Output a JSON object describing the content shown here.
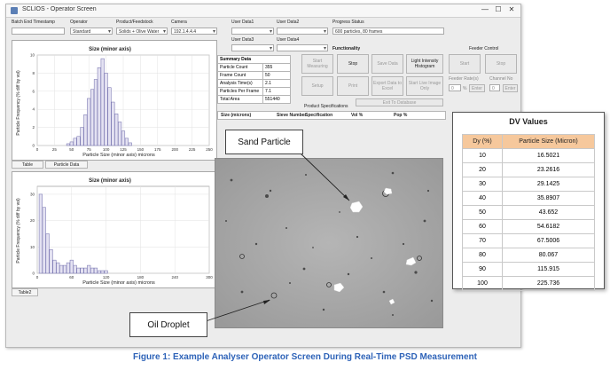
{
  "window": {
    "title": "SCLIOS - Operator Screen",
    "controls": [
      "—",
      "☐",
      "✕"
    ]
  },
  "header": {
    "labels": [
      "Batch End Timestamp",
      "Operator",
      "Product/Feedstock",
      "Camera",
      "User Data1",
      "User Data2",
      "Progress Status"
    ],
    "operator_value": "Standard",
    "product_value": "Solids + Olive Water",
    "camera_value": "192.1.4.4.4",
    "progress_value": "600 particles, 80 frames",
    "user_data3_label": "User Data3",
    "user_data4_label": "User Data4"
  },
  "chart1": {
    "title": "Size (minor axis)",
    "ylabel": "Particle Frequency (% diff by vol)",
    "xlabel": "Particle Size (minor axis) microns",
    "xticks": [
      "0",
      "25",
      "50",
      "75",
      "100",
      "125",
      "150",
      "175",
      "200",
      "225",
      "250"
    ],
    "yticks": [
      "0",
      "2",
      "4",
      "6",
      "8",
      "10"
    ]
  },
  "chart2": {
    "title": "Size (minor axis)",
    "ylabel": "Particle Frequency (% diff by vol)",
    "xlabel": "Particle Size (minor axis) microns",
    "xticks": [
      "0",
      "60",
      "120",
      "180",
      "240",
      "300"
    ],
    "yticks": [
      "0",
      "10",
      "20",
      "30"
    ]
  },
  "tabs": {
    "table": "Table",
    "particle_data": "Particle Data",
    "table2": "Table2"
  },
  "summary": {
    "header": "Summary Data",
    "rows": [
      {
        "label": "Particle Count",
        "value": "355"
      },
      {
        "label": "Frame Count",
        "value": "50"
      },
      {
        "label": "Analysis Time(s)",
        "value": "2.1"
      },
      {
        "label": "Particles Per Frame",
        "value": "7.1"
      },
      {
        "label": "Total Area",
        "value": "551440"
      }
    ]
  },
  "functionality": {
    "label": "Functionality",
    "buttons": [
      "Start Measuring",
      "Stop",
      "Save Data",
      "Light Intensity Histogram",
      "Setup",
      "Print",
      "Export Data to Excel",
      "Start Live Image Only"
    ],
    "exit": "Exit To Database",
    "product_specs": "Product Specifications"
  },
  "feeder": {
    "label": "Feeder Control",
    "start": "Start",
    "stop": "Stop",
    "rate_label": "Feeder Rate(s)",
    "rate_value": "0",
    "rate_unit": "%",
    "rate_btn": "Enter",
    "channel_label": "Channel No",
    "channel_value": "0",
    "channel_btn": "Enter"
  },
  "spec_table": {
    "headers": [
      "Size (microns)",
      "Sieve Number",
      "Specification",
      "Vol %",
      "Pop %"
    ]
  },
  "callouts": {
    "sand": "Sand Particle",
    "oil": "Oil Droplet"
  },
  "dv_values": {
    "title": "DV Values",
    "col1": "Dy (%)",
    "col2": "Particle Size (Micron)",
    "rows": [
      {
        "dy": "10",
        "size": "16.5021"
      },
      {
        "dy": "20",
        "size": "23.2616"
      },
      {
        "dy": "30",
        "size": "29.1425"
      },
      {
        "dy": "40",
        "size": "35.8907"
      },
      {
        "dy": "50",
        "size": "43.652"
      },
      {
        "dy": "60",
        "size": "54.6182"
      },
      {
        "dy": "70",
        "size": "67.5006"
      },
      {
        "dy": "80",
        "size": "80.067"
      },
      {
        "dy": "90",
        "size": "115.915"
      },
      {
        "dy": "100",
        "size": "225.736"
      }
    ]
  },
  "caption": "Figure 1: Example Analyser Operator Screen During Real-Time PSD Measurement",
  "chart_data": [
    {
      "type": "bar",
      "title": "Size (minor axis)",
      "xlabel": "Particle Size (minor axis) microns",
      "ylabel": "Particle Frequency (% diff by vol)",
      "xlim": [
        0,
        250
      ],
      "ylim": [
        0,
        10
      ],
      "x": [
        45,
        50,
        55,
        60,
        65,
        70,
        75,
        80,
        85,
        90,
        95,
        100,
        105,
        110,
        115,
        120,
        125,
        130,
        135
      ],
      "values": [
        0.2,
        0.4,
        0.8,
        1.0,
        2.0,
        3.4,
        5.2,
        6.2,
        7.3,
        8.6,
        9.6,
        8.0,
        6.4,
        4.8,
        3.5,
        2.6,
        1.6,
        0.8,
        0.3
      ]
    },
    {
      "type": "bar",
      "title": "Size (minor axis)",
      "xlabel": "Particle Size (minor axis) microns",
      "ylabel": "Particle Frequency (% diff by vol)",
      "xlim": [
        0,
        300
      ],
      "ylim": [
        0,
        33
      ],
      "x": [
        6,
        12,
        18,
        24,
        30,
        36,
        42,
        48,
        54,
        60,
        66,
        72,
        78,
        84,
        90,
        96,
        102,
        108,
        114,
        120
      ],
      "values": [
        30,
        25,
        15,
        9,
        5,
        4,
        3,
        3,
        4,
        5,
        3,
        2,
        2,
        2,
        3,
        2,
        2,
        1,
        1,
        1
      ]
    }
  ]
}
